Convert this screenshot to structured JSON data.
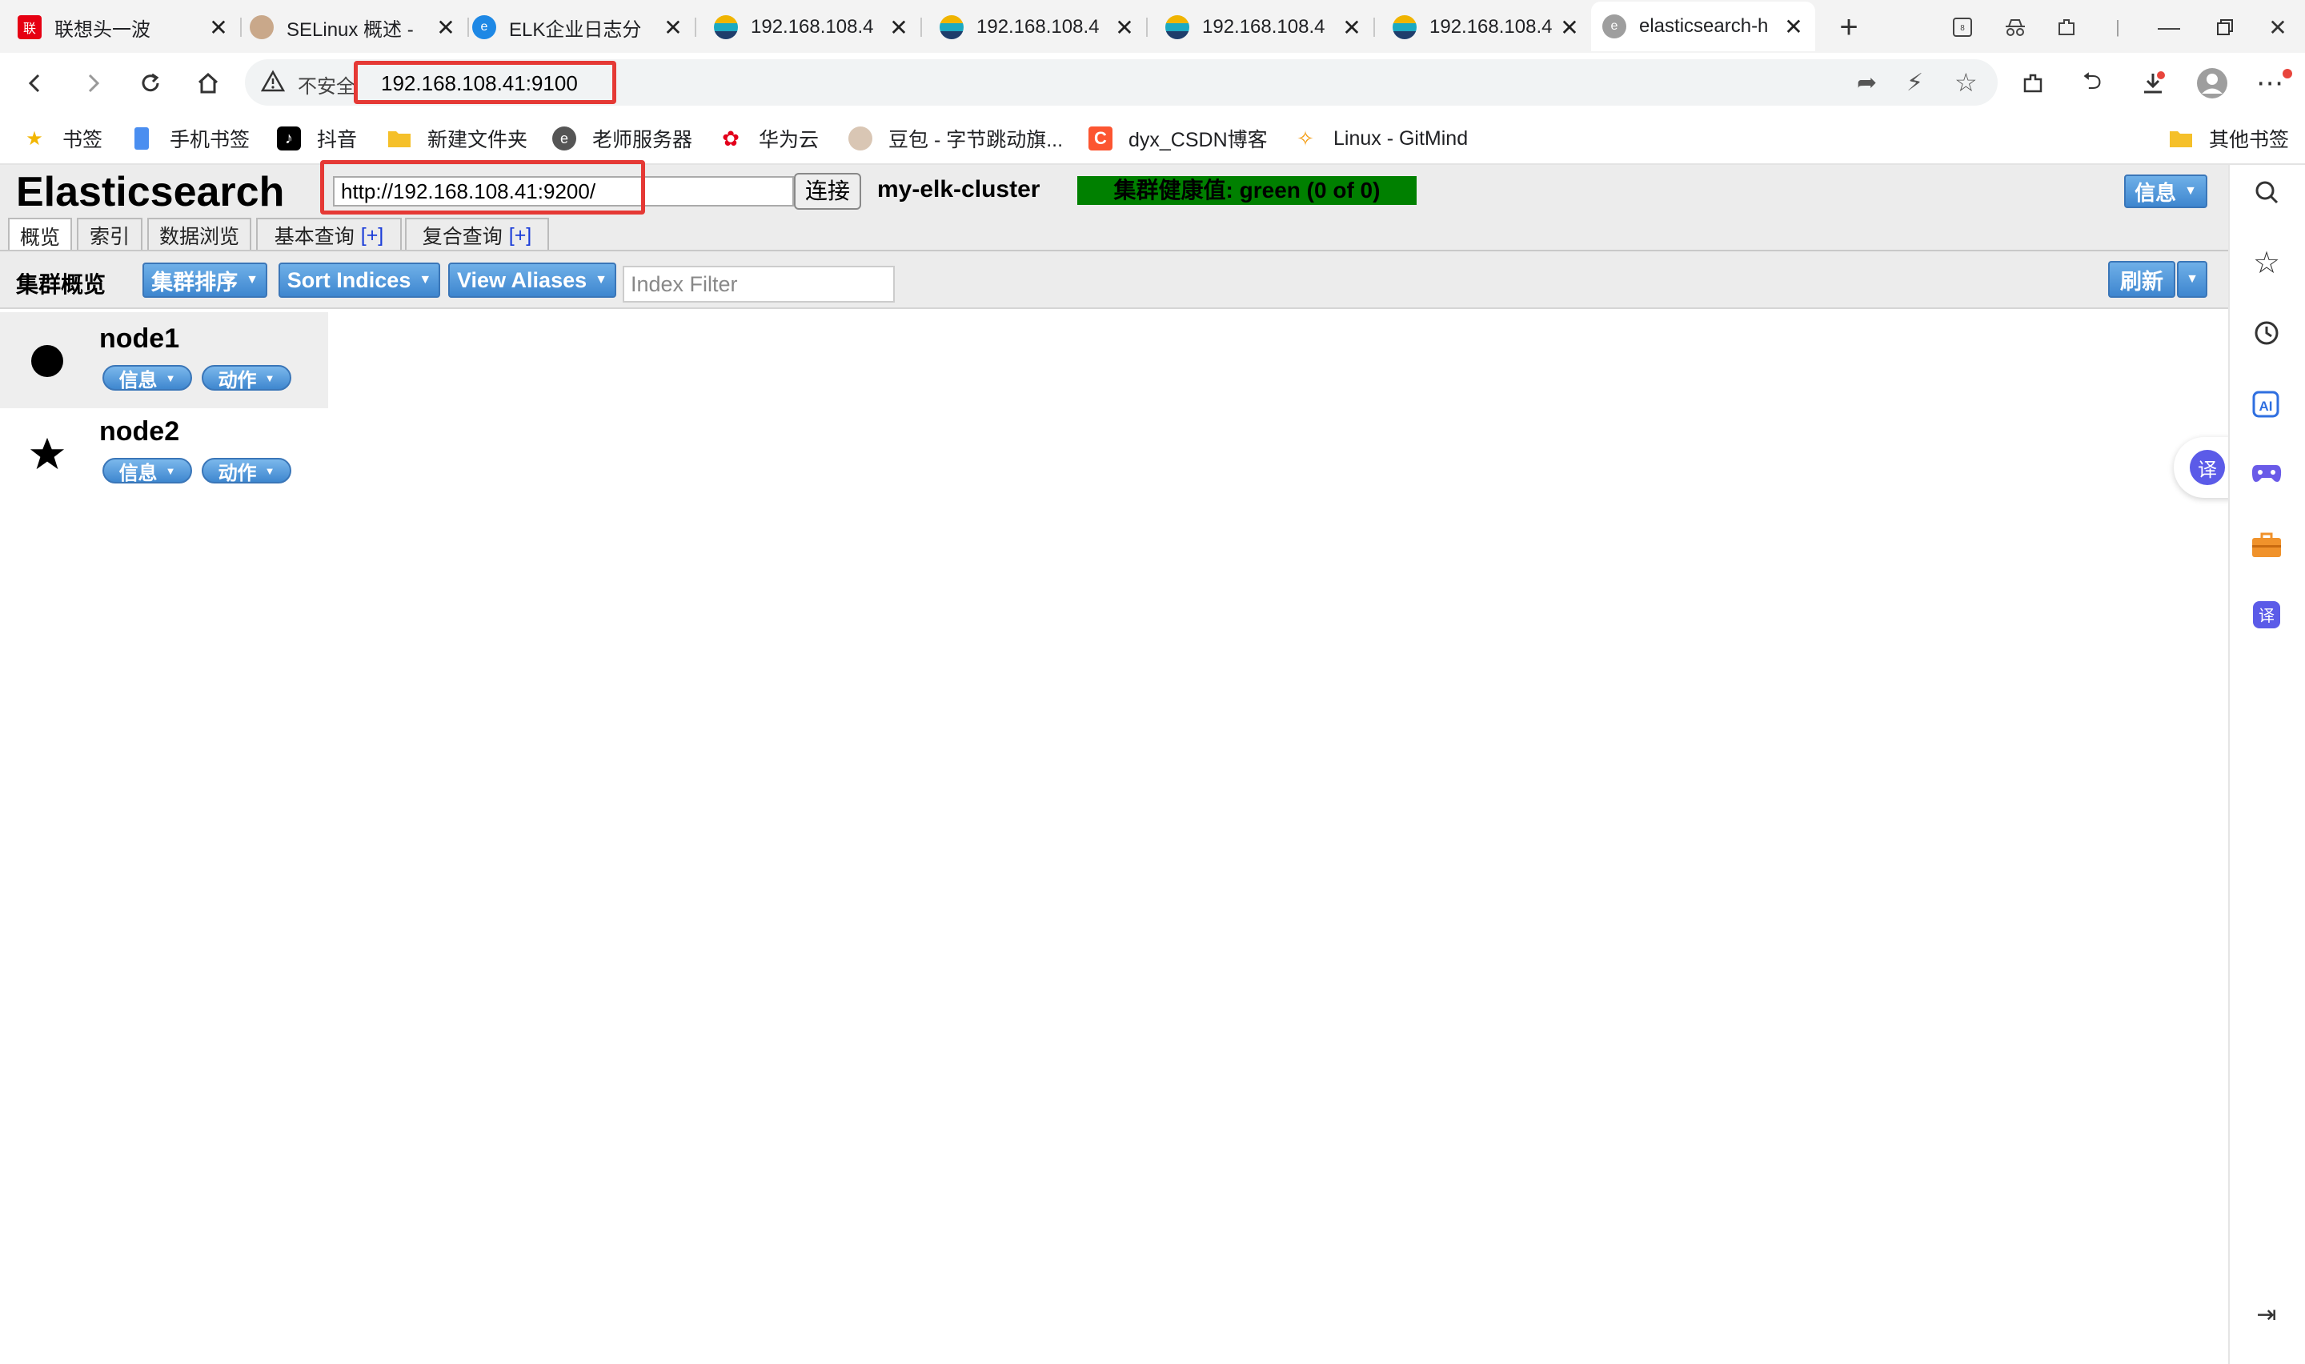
{
  "browser": {
    "tabs": [
      {
        "title": "联想头一波",
        "icon": "lenovo-icon"
      },
      {
        "title": "SELinux 概述 - ",
        "icon": "avatar-icon"
      },
      {
        "title": "ELK企业日志分",
        "icon": "edge-icon"
      },
      {
        "title": "192.168.108.4",
        "icon": "elastic-icon"
      },
      {
        "title": "192.168.108.4",
        "icon": "elastic-icon"
      },
      {
        "title": "192.168.108.4",
        "icon": "elastic-icon"
      },
      {
        "title": "192.168.108.4",
        "icon": "elastic-icon"
      },
      {
        "title": "elasticsearch-h",
        "icon": "elastic-icon",
        "active": true
      }
    ],
    "address": {
      "security_label": "不安全",
      "url": "192.168.108.41:9100"
    },
    "bookmarks": [
      {
        "label": "书签",
        "icon": "star-icon"
      },
      {
        "label": "手机书签",
        "icon": "phone-icon"
      },
      {
        "label": "抖音",
        "icon": "douyin-icon"
      },
      {
        "label": "新建文件夹",
        "icon": "folder-icon"
      },
      {
        "label": "老师服务器",
        "icon": "edge-icon"
      },
      {
        "label": "华为云",
        "icon": "huawei-icon"
      },
      {
        "label": "豆包 - 字节跳动旗...",
        "icon": "doubao-icon"
      },
      {
        "label": "dyx_CSDN博客",
        "icon": "csdn-icon"
      },
      {
        "label": "Linux - GitMind",
        "icon": "gitmind-icon"
      }
    ],
    "other_bookmarks": "其他书签"
  },
  "app": {
    "title": "Elasticsearch",
    "connect_url": "http://192.168.108.41:9200/",
    "connect_button": "连接",
    "cluster_name": "my-elk-cluster",
    "cluster_health": "集群健康值: green (0 of 0)",
    "health_color": "#008000",
    "info_button": "信息",
    "tabs": [
      {
        "label": "概览",
        "active": true
      },
      {
        "label": "索引"
      },
      {
        "label": "数据浏览"
      },
      {
        "label": "基本查询",
        "plus": "[+]"
      },
      {
        "label": "复合查询",
        "plus": "[+]"
      }
    ],
    "toolbar": {
      "overview_label": "集群概览",
      "cluster_sort": "集群排序",
      "sort_indices": "Sort Indices",
      "view_aliases": "View Aliases",
      "index_filter_placeholder": "Index Filter",
      "refresh": "刷新"
    },
    "nodes": [
      {
        "name": "node1",
        "symbol": "circle",
        "info": "信息",
        "action": "动作"
      },
      {
        "name": "node2",
        "symbol": "star",
        "info": "信息",
        "action": "动作"
      }
    ]
  },
  "side_panel": {
    "icons": [
      "search-icon",
      "favorites-icon",
      "history-icon",
      "ai-icon",
      "game-icon",
      "toolbox-icon",
      "translate-icon",
      "collapse-icon"
    ],
    "floating_translate": "译"
  }
}
